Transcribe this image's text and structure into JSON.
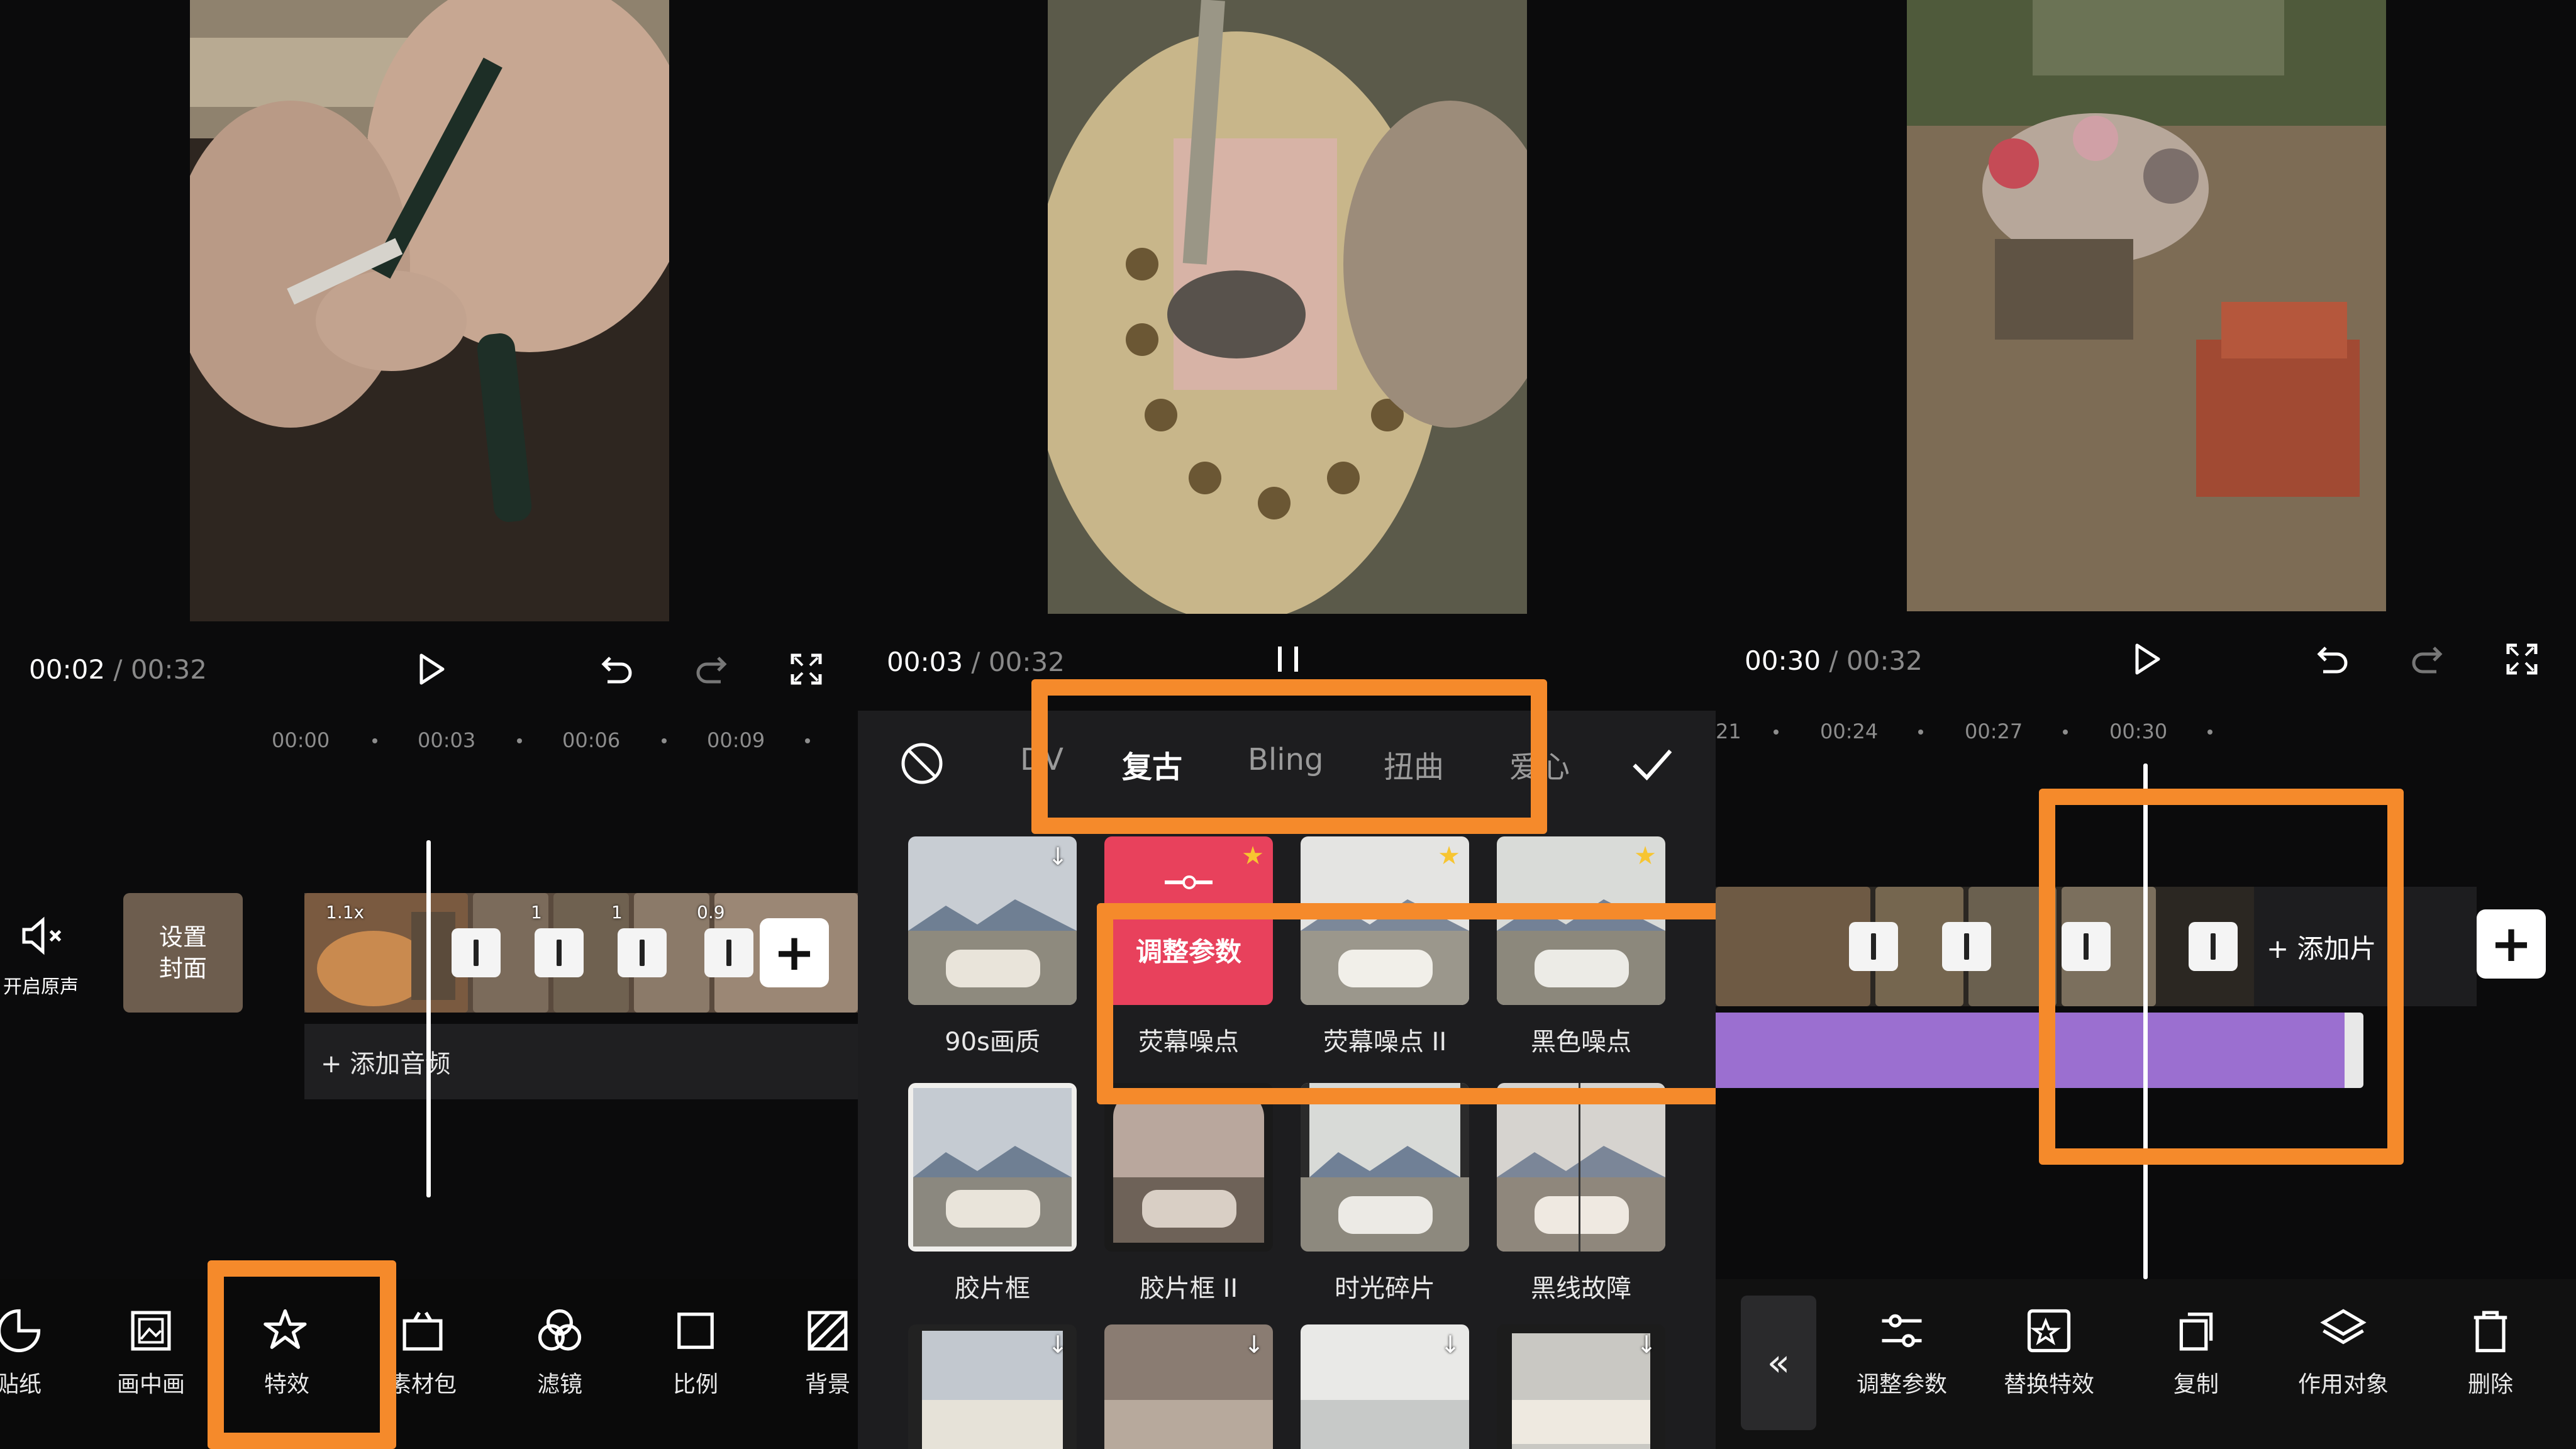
{
  "panel1": {
    "time_current": "00:02",
    "time_separator": "/",
    "time_total": "00:32",
    "ruler": [
      "00:00",
      "00:03",
      "00:06",
      "00:09"
    ],
    "mute_label": "开启原声",
    "cover_label_line1": "设置",
    "cover_label_line2": "封面",
    "speeds": [
      "1.1x",
      "1",
      "1",
      "0.9"
    ],
    "add_audio": "+ 添加音频",
    "toolbar": [
      "贴纸",
      "画中画",
      "特效",
      "素材包",
      "滤镜",
      "比例",
      "背景"
    ]
  },
  "panel2": {
    "time_current": "00:03",
    "time_separator": "/",
    "time_total": "00:32",
    "tabs": [
      "DV",
      "复古",
      "Bling",
      "扭曲",
      "爱心"
    ],
    "adjust_overlay": "调整参数",
    "effects": [
      {
        "label": "90s画质",
        "badge": "download"
      },
      {
        "label": "荧幕噪点",
        "badge": "star"
      },
      {
        "label": "荧幕噪点 II",
        "badge": "star"
      },
      {
        "label": "黑色噪点",
        "badge": "star"
      },
      {
        "label": "胶片框",
        "badge": ""
      },
      {
        "label": "胶片框 II",
        "badge": ""
      },
      {
        "label": "时光碎片",
        "badge": ""
      },
      {
        "label": "黑线故障",
        "badge": ""
      },
      {
        "label": "",
        "badge": "download"
      },
      {
        "label": "",
        "badge": "download"
      },
      {
        "label": "",
        "badge": "download"
      },
      {
        "label": "",
        "badge": "download"
      }
    ]
  },
  "panel3": {
    "time_current": "00:30",
    "time_separator": "/",
    "time_total": "00:32",
    "ruler": [
      "21",
      "00:24",
      "00:27",
      "00:30"
    ],
    "add_clip": "+ 添加片",
    "toolbar": [
      "调整参数",
      "替换特效",
      "复制",
      "作用对象",
      "删除"
    ]
  },
  "colors": {
    "highlight": "#f58a2b",
    "effect_track": "#9b6fd0",
    "adjust_pink": "#e8415c",
    "star": "#f7c531"
  }
}
